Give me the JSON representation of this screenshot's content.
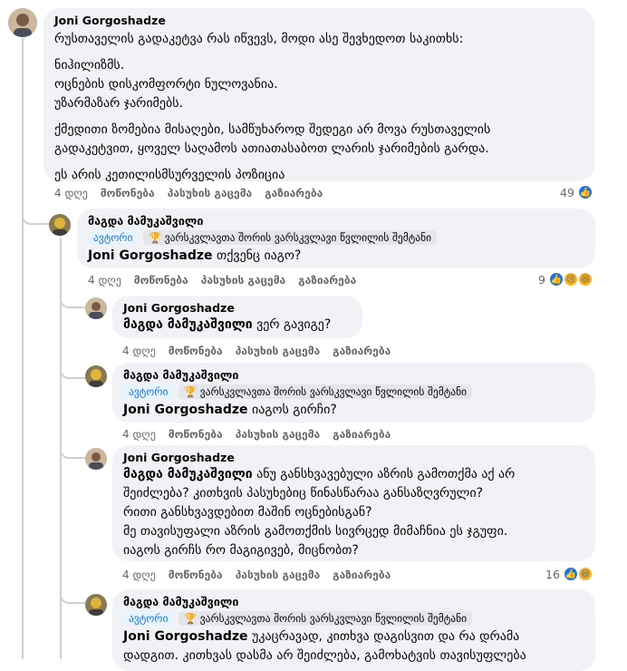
{
  "c1": {
    "author": "Joni Gorgoshadze",
    "lines": [
      "რუსთაველის გადაკეტვა რას იწვევს, მოდი ასე შევხედოთ საკითხს:",
      "",
      "ნიჰილიზმს.",
      "ოცნების დისკომფორტი ნულოვანია.",
      "უზარმაზარ ჯარიმებს.",
      "",
      "ქმედითი ზომებია მისაღები, სამწუხაროდ შედეგი არ მოვა რუსთაველის",
      "გადაკეტვით, ყოველ საღამოს ათიათასაბოთ ლარის ჯარიმების გარდა.",
      "",
      "ეს არის კეთილისმსურველის პოზიცია"
    ],
    "time": "4 დღე",
    "like": "მოწონება",
    "reply": "პასუხის გაცემა",
    "share": "გაზიარება",
    "react_count": "49"
  },
  "c2": {
    "author": "მაგდა მამუკაშვილი",
    "badge_author": "ავტორი",
    "badge_fan": "ვარსკვლავთა შორის ვარსკვლავი წვლილის შემტანი",
    "mention": "Joni Gorgoshadze",
    "text": "თქვენც იაგო?",
    "time": "4 დღე",
    "like": "მოწონება",
    "reply": "პასუხის გაცემა",
    "share": "გაზიარება",
    "react_count": "9"
  },
  "c3": {
    "author": "Joni Gorgoshadze",
    "mention": "მაგდა მამუკაშვილი",
    "text": "ვერ გავიგე?",
    "time": "4 დღე",
    "like": "მოწონება",
    "reply": "პასუხის გაცემა",
    "share": "გაზიარება"
  },
  "c4": {
    "author": "მაგდა მამუკაშვილი",
    "badge_author": "ავტორი",
    "badge_fan": "ვარსკვლავთა შორის ვარსკვლავი წვლილის შემტანი",
    "mention": "Joni Gorgoshadze",
    "text": "იაგოს გირჩი?",
    "time": "4 დღე",
    "like": "მოწონება",
    "reply": "პასუხის გაცემა",
    "share": "გაზიარება"
  },
  "c5": {
    "author": "Joni Gorgoshadze",
    "mention": "მაგდა მამუკაშვილი",
    "line1": "ანუ განსხვავებული აზრის გამოთქმა აქ არ",
    "lines": [
      "შეიძლება? კითხვის პასუხებიც წინასწარაა განსაზღვრული?",
      "რითი განსხვავდებით მაშინ ოცნებისგან?",
      "მე თავისუფალი აზრის გამოთქმის სივრცედ მიმაჩნია ეს ჯგუფი.",
      "იაგოს გირჩს რო მაგიგივებ, მიცნობთ?"
    ],
    "time": "4 დღე",
    "like": "მოწონება",
    "reply": "პასუხის გაცემა",
    "share": "გაზიარება",
    "react_count": "16"
  },
  "c6": {
    "author": "მაგდა მამუკაშვილი",
    "badge_author": "ავტორი",
    "badge_fan": "ვარსკვლავთა შორის ვარსკვლავი წვლილის შემტანი",
    "mention": "Joni Gorgoshadze",
    "line1": "უკაცრავად, კითხვა დაგისვით და რა დრამა",
    "line2": "დადგით. კითხვას დასმა არ შეიძლება, გამოხატვის თავისუფლება"
  },
  "colors": {
    "accent": "#1b74e4",
    "bubble": "#f0f2f5",
    "meta": "#65676b"
  },
  "icons": {
    "like": "thumbs-up-icon",
    "sad": "sad-face-icon",
    "haha": "laugh-face-icon",
    "fan": "trophy-icon"
  }
}
